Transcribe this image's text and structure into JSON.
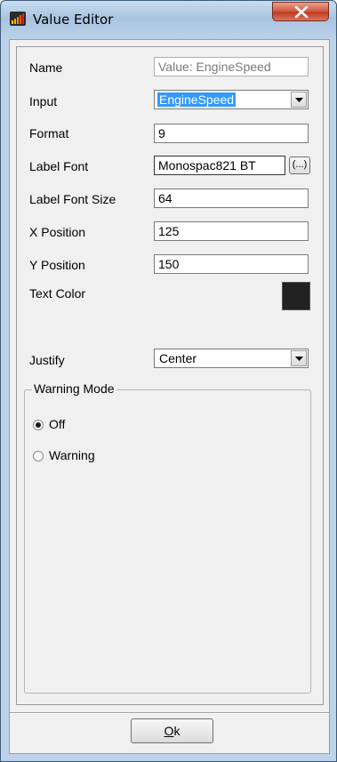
{
  "window": {
    "title": "Value Editor",
    "close_glyph": "X",
    "app_icon": "bar-chart-icon"
  },
  "form": {
    "name": {
      "label": "Name",
      "value": "Value: EngineSpeed"
    },
    "input": {
      "label": "Input",
      "selected": "EngineSpeed"
    },
    "format": {
      "label": "Format",
      "value": "9"
    },
    "label_font": {
      "label": "Label Font",
      "value": "Monospac821 BT",
      "browse_label": "(...)"
    },
    "label_font_size": {
      "label": "Label Font Size",
      "value": "64"
    },
    "x_position": {
      "label": "X Position",
      "value": "125"
    },
    "y_position": {
      "label": "Y Position",
      "value": "150"
    },
    "text_color": {
      "label": "Text Color",
      "color": "#222222"
    },
    "justify": {
      "label": "Justify",
      "selected": "Center"
    }
  },
  "warning_mode": {
    "title": "Warning Mode",
    "options": [
      {
        "label": "Off",
        "checked": true
      },
      {
        "label": "Warning",
        "checked": false
      }
    ]
  },
  "footer": {
    "ok_mnemonic": "O",
    "ok_rest": "k"
  }
}
